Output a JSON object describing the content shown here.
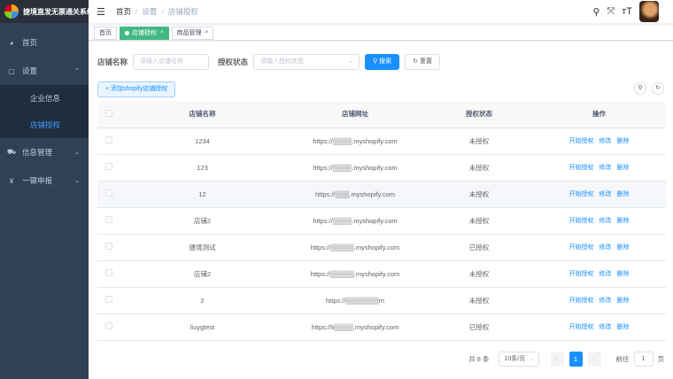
{
  "app": {
    "title": "捷境直发无票通关系统"
  },
  "sidebar": {
    "items": [
      {
        "label": "首页",
        "icon": "dashboard-icon",
        "glyph": "◕"
      },
      {
        "label": "设置",
        "icon": "settings-icon",
        "glyph": "▢",
        "expanded": true,
        "children": [
          {
            "label": "企业信息"
          },
          {
            "label": "店铺授权",
            "active": true
          }
        ]
      },
      {
        "label": "信息管理",
        "icon": "cart-icon",
        "glyph": "⛟"
      },
      {
        "label": "一键申报",
        "icon": "yen-icon",
        "glyph": "¥"
      }
    ]
  },
  "navbar": {
    "breadcrumb": [
      "首页",
      "设置",
      "店铺授权"
    ],
    "icons": {
      "search": "⚲",
      "fullscreen": "⤧",
      "size": "ᴛT"
    }
  },
  "tags": [
    {
      "label": "首页",
      "active": false
    },
    {
      "label": "店铺授权",
      "active": true
    },
    {
      "label": "商品管理",
      "active": false
    }
  ],
  "filter": {
    "shop_name_label": "店铺名称",
    "shop_name_placeholder": "请输入店铺名称",
    "auth_status_label": "授权状态",
    "auth_status_placeholder": "请输入授权状态",
    "search_label": "搜索",
    "reset_label": "重置"
  },
  "toolbar": {
    "add_label": "添加shopify店铺授权"
  },
  "table": {
    "headers": [
      "店铺名称",
      "店铺网址",
      "授权状态",
      "操作"
    ],
    "rows": [
      {
        "name": "1234",
        "url": "https://▒▒▒▒.myshopify.com",
        "status": "未授权"
      },
      {
        "name": "123",
        "url": "https://▒▒▒▒.myshopify.com",
        "status": "未授权"
      },
      {
        "name": "12",
        "url": "https://▒▒▒.myshopify.com",
        "status": "未授权"
      },
      {
        "name": "店铺2",
        "url": "https://▒▒▒▒.myshopify.com",
        "status": "未授权"
      },
      {
        "name": "捷境测试",
        "url": "https://▒▒▒▒▒.myshopify.com",
        "status": "已授权"
      },
      {
        "name": "店铺2",
        "url": "https://▒▒▒▒▒.myshopify.com",
        "status": "未授权"
      },
      {
        "name": "2",
        "url": "https://▒▒▒▒▒▒▒m",
        "status": "未授权"
      },
      {
        "name": "liuygtest",
        "url": "https://li▒▒▒▒.myshopify.com",
        "status": "已授权"
      }
    ],
    "actions": [
      "开始授权",
      "修改",
      "删除"
    ]
  },
  "pagination": {
    "total_text": "共 8 条",
    "page_size": "10条/页",
    "current_page": "1",
    "goto_label": "前往",
    "goto_value": "1",
    "page_unit": "页"
  }
}
